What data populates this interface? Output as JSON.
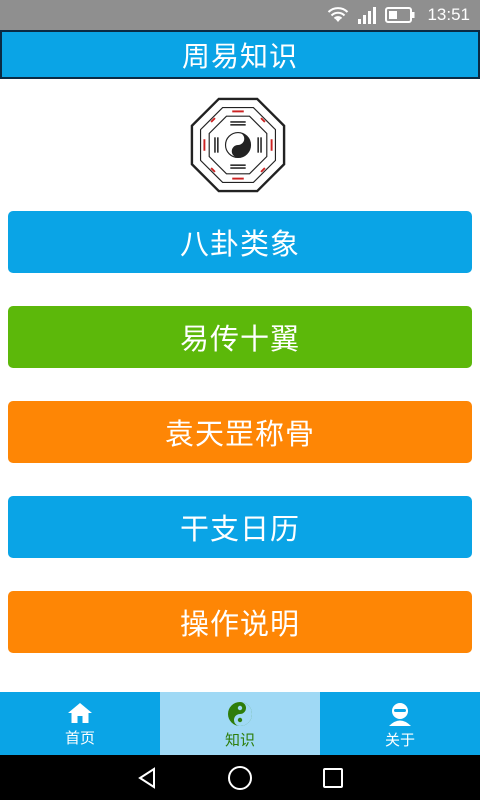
{
  "status_bar": {
    "time": "13:51",
    "icons": [
      "wifi-icon",
      "signal-icon",
      "battery-icon"
    ]
  },
  "header": {
    "title": "周易知识"
  },
  "logo": {
    "icon": "bagua-taiji-icon"
  },
  "menu": {
    "items": [
      {
        "label": "八卦类象",
        "color": "#0aa4e6"
      },
      {
        "label": "易传十翼",
        "color": "#5cb80a"
      },
      {
        "label": "袁天罡称骨",
        "color": "#fe8605"
      },
      {
        "label": "干支日历",
        "color": "#0aa4e6"
      },
      {
        "label": "操作说明",
        "color": "#fe8605"
      }
    ]
  },
  "tabs": [
    {
      "label": "首页",
      "icon": "home-icon",
      "active": false
    },
    {
      "label": "知识",
      "icon": "yin-yang-icon",
      "active": true
    },
    {
      "label": "关于",
      "icon": "person-icon",
      "active": false
    }
  ],
  "nav_bar": {
    "keys": [
      "back-icon",
      "home-circle-icon",
      "recents-icon"
    ]
  },
  "colors": {
    "primary": "#0aa4e6",
    "green": "#5cb80a",
    "orange": "#fe8605",
    "active_tab": "#9fd9f5"
  }
}
